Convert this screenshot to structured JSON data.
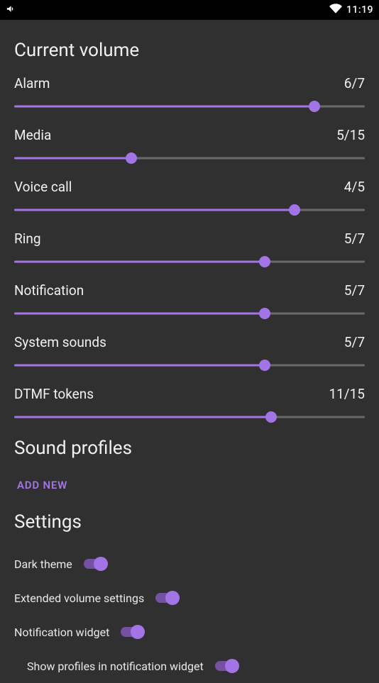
{
  "status": {
    "time": "11:19"
  },
  "sections": {
    "current_volume": "Current volume",
    "sound_profiles": "Sound profiles",
    "settings": "Settings"
  },
  "sliders": [
    {
      "label": "Alarm",
      "value": 6,
      "max": 7
    },
    {
      "label": "Media",
      "value": 5,
      "max": 15
    },
    {
      "label": "Voice call",
      "value": 4,
      "max": 5
    },
    {
      "label": "Ring",
      "value": 5,
      "max": 7
    },
    {
      "label": "Notification",
      "value": 5,
      "max": 7
    },
    {
      "label": "System sounds",
      "value": 5,
      "max": 7
    },
    {
      "label": "DTMF tokens",
      "value": 11,
      "max": 15
    }
  ],
  "buttons": {
    "add_new": "ADD NEW"
  },
  "toggles": [
    {
      "label": "Dark theme",
      "on": true,
      "indent": false
    },
    {
      "label": "Extended volume settings",
      "on": true,
      "indent": false
    },
    {
      "label": "Notification widget",
      "on": true,
      "indent": false
    },
    {
      "label": "Show profiles in notification widget",
      "on": true,
      "indent": true
    }
  ]
}
